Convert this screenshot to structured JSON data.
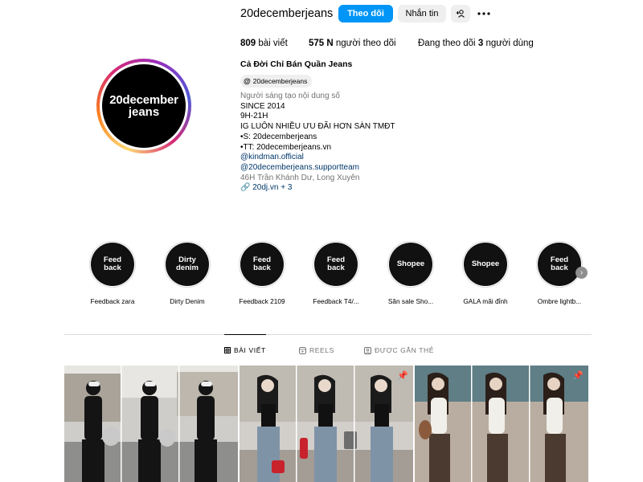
{
  "profile": {
    "username": "20decemberjeans",
    "follow_label": "Theo dõi",
    "message_label": "Nhắn tin",
    "add_user_label": "+ʟ",
    "avatar_text_line1": "20december",
    "avatar_text_line2": "jeans",
    "stats": {
      "posts_count": "809",
      "posts_label": "bài viết",
      "followers_count": "575 N",
      "followers_label": "người theo dõi",
      "following_label": "Đang theo dõi",
      "following_count": "3",
      "following_suffix": "người dùng"
    },
    "full_name": "Cả Đời Chỉ Bán Quần Jeans",
    "threads_handle": "20decemberjeans",
    "category": "Người sáng tạo nội dung số",
    "bio_lines": [
      "SINCE 2014",
      "9H-21H",
      "IG LUÔN NHIỀU ƯU ĐÃI HƠN SÀN TMĐT",
      "•S: 20decemberjeans",
      "•TT: 20decemberjeans.vn"
    ],
    "mentions": [
      "@kindman.official",
      "@20decemberjeans.supportteam"
    ],
    "address": "46H Trần Khánh Dư, Long Xuyên",
    "website": "20dj.vn + 3"
  },
  "highlights": [
    {
      "cover": "Feed\nback",
      "label": "Feedback zara"
    },
    {
      "cover": "Dirty\ndenim",
      "label": "Dirty Denim"
    },
    {
      "cover": "Feed\nback",
      "label": "Feedback 2109"
    },
    {
      "cover": "Feed\nback",
      "label": "Feedback T4/..."
    },
    {
      "cover": "Shopee",
      "label": "Săn sale Sho..."
    },
    {
      "cover": "Shopee",
      "label": "GALA mãi đỉnh"
    },
    {
      "cover": "Feed\nback",
      "label": "Ombre lightb..."
    }
  ],
  "tabs": {
    "posts": "BÀI VIẾT",
    "reels": "REELS",
    "tagged": "ĐƯỢC GẮN THẺ"
  },
  "icons": {
    "more": "more-horizontal-icon",
    "threads": "threads-icon",
    "link": "link-icon",
    "grid": "grid-icon",
    "reels": "reels-icon",
    "tagged": "tagged-icon",
    "pin": "pin-icon",
    "next": "chevron-right-icon"
  },
  "colors": {
    "follow_button": "#0095f6",
    "secondary_button": "#efefef",
    "link": "#00376b",
    "muted": "#737373"
  }
}
